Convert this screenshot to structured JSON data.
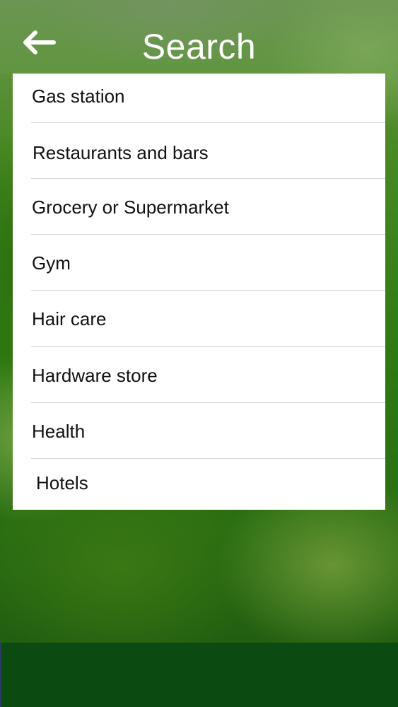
{
  "header": {
    "title": "Search",
    "back_icon": "arrow-left-icon"
  },
  "categories": [
    "Gas station",
    "Restaurants and bars",
    "Grocery or Supermarket",
    "Gym",
    "Hair care",
    "Hardware store",
    "Health",
    "Hotels"
  ],
  "colors": {
    "bottom_bar": "#0b4a11",
    "card": "#ffffff",
    "title_text": "#ffffff"
  }
}
